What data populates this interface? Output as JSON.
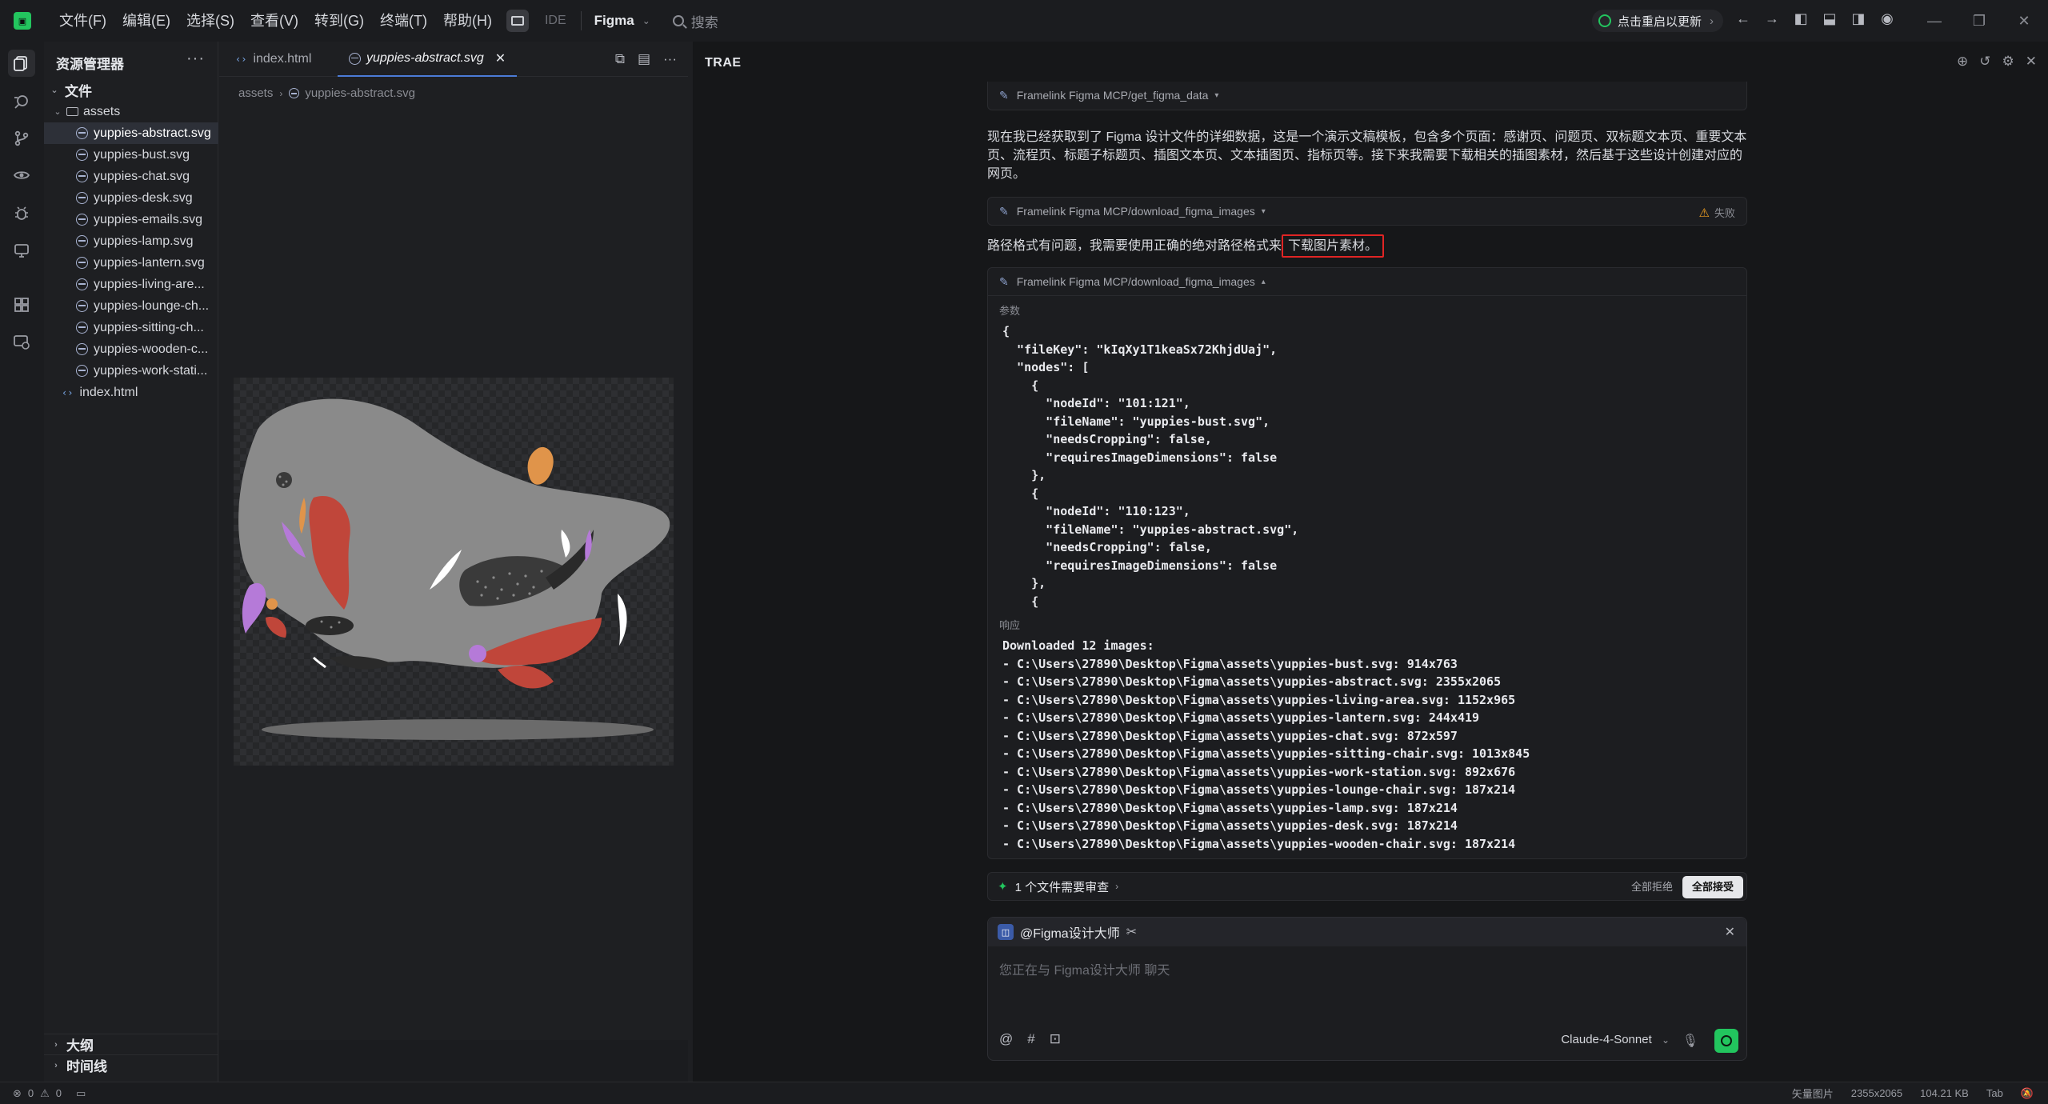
{
  "menus": [
    "文件(F)",
    "编辑(E)",
    "选择(S)",
    "查看(V)",
    "转到(G)",
    "终端(T)",
    "帮助(H)"
  ],
  "mode": {
    "ide_label": "IDE"
  },
  "project": {
    "name": "Figma"
  },
  "search": {
    "label": "搜索"
  },
  "update": {
    "label": "点击重启以更新"
  },
  "explorer": {
    "title": "资源管理器",
    "root_label": "文件",
    "folder": "assets",
    "files": [
      "yuppies-abstract.svg",
      "yuppies-bust.svg",
      "yuppies-chat.svg",
      "yuppies-desk.svg",
      "yuppies-emails.svg",
      "yuppies-lamp.svg",
      "yuppies-lantern.svg",
      "yuppies-living-are...",
      "yuppies-lounge-ch...",
      "yuppies-sitting-ch...",
      "yuppies-wooden-c...",
      "yuppies-work-stati..."
    ],
    "root_file": "index.html",
    "outline": "大纲",
    "timeline": "时间线"
  },
  "editor": {
    "tabs": [
      {
        "label": "index.html"
      },
      {
        "label": "yuppies-abstract.svg"
      }
    ],
    "breadcrumb": [
      "assets",
      "yuppies-abstract.svg"
    ]
  },
  "chat": {
    "title": "TRAE",
    "tool1": "Framelink Figma MCP/get_figma_data",
    "msg1": "现在我已经获取到了 Figma 设计文件的详细数据，这是一个演示文稿模板，包含多个页面：感谢页、问题页、双标题文本页、重要文本页、流程页、标题子标题页、插图文本页、文本插图页、指标页等。接下来我需要下载相关的插图素材，然后基于这些设计创建对应的网页。",
    "tool2": "Framelink Figma MCP/download_figma_images",
    "tool2_status": "失败",
    "msg2_prefix": "路径格式有问题，我需要使用正确的绝对路径格式来",
    "msg2_highlight": "下载图片素材。",
    "tool3": "Framelink Figma MCP/download_figma_images",
    "params_label": "参数",
    "params_code": "{\n  \"fileKey\": \"kIqXy1T1keaSx72KhjdUaj\",\n  \"nodes\": [\n    {\n      \"nodeId\": \"101:121\",\n      \"fileName\": \"yuppies-bust.svg\",\n      \"needsCropping\": false,\n      \"requiresImageDimensions\": false\n    },\n    {\n      \"nodeId\": \"110:123\",\n      \"fileName\": \"yuppies-abstract.svg\",\n      \"needsCropping\": false,\n      \"requiresImageDimensions\": false\n    },\n    {",
    "response_label": "响应",
    "response_code": "Downloaded 12 images:\n- C:\\Users\\27890\\Desktop\\Figma\\assets\\yuppies-bust.svg: 914x763\n- C:\\Users\\27890\\Desktop\\Figma\\assets\\yuppies-abstract.svg: 2355x2065\n- C:\\Users\\27890\\Desktop\\Figma\\assets\\yuppies-living-area.svg: 1152x965\n- C:\\Users\\27890\\Desktop\\Figma\\assets\\yuppies-lantern.svg: 244x419\n- C:\\Users\\27890\\Desktop\\Figma\\assets\\yuppies-chat.svg: 872x597\n- C:\\Users\\27890\\Desktop\\Figma\\assets\\yuppies-sitting-chair.svg: 1013x845\n- C:\\Users\\27890\\Desktop\\Figma\\assets\\yuppies-work-station.svg: 892x676\n- C:\\Users\\27890\\Desktop\\Figma\\assets\\yuppies-lounge-chair.svg: 187x214\n- C:\\Users\\27890\\Desktop\\Figma\\assets\\yuppies-lamp.svg: 187x214\n- C:\\Users\\27890\\Desktop\\Figma\\assets\\yuppies-desk.svg: 187x214\n- C:\\Users\\27890\\Desktop\\Figma\\assets\\yuppies-wooden-chair.svg: 187x214",
    "review_text": "1 个文件需要审查",
    "reject_all": "全部拒绝",
    "accept_all": "全部接受",
    "agent_name": "@Figma设计大师",
    "placeholder": "您正在与 Figma设计大师 聊天",
    "model": "Claude-4-Sonnet"
  },
  "status": {
    "errors": "0",
    "warnings": "0",
    "image_type": "矢量图片",
    "dimensions": "2355x2065",
    "size": "104.21 KB",
    "indent": "Tab"
  },
  "colors": {
    "accent": "#22c55e",
    "highlight_border": "#e02424"
  }
}
